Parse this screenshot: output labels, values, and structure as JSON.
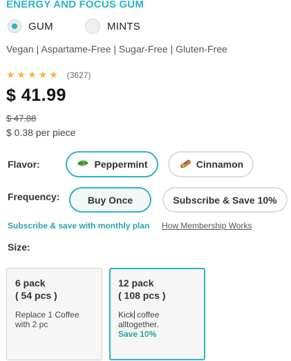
{
  "product": {
    "title": "ENERGY AND FOCUS GUM",
    "type_options": [
      {
        "label": "GUM",
        "selected": true
      },
      {
        "label": "MINTS",
        "selected": false
      }
    ],
    "attributes": "Vegan | Aspartame-Free | Sugar-Free | Gluten-Free",
    "rating": {
      "stars": "★★★★★",
      "value": 5,
      "review_count": "(3627)"
    },
    "price": "$ 41.99",
    "compare_price": "$ 47.88",
    "per_piece": "$ 0.38 per piece"
  },
  "flavor": {
    "label": "Flavor:",
    "options": [
      {
        "label": "Peppermint",
        "icon": "mint-leaf-icon",
        "selected": true
      },
      {
        "label": "Cinnamon",
        "icon": "cinnamon-stick-icon",
        "selected": false
      }
    ]
  },
  "frequency": {
    "label": "Frequency:",
    "options": [
      {
        "label": "Buy Once",
        "selected": true
      },
      {
        "label": "Subscribe & Save 10%",
        "selected": false
      }
    ]
  },
  "subscribe": {
    "text": "Subscribe & save with monthly plan",
    "link": "How Membership Works"
  },
  "size": {
    "label": "Size:",
    "options": [
      {
        "title": "6 pack",
        "count": "( 54 pcs )",
        "desc": "Replace 1 Coffee with 2 pc",
        "selected": false
      },
      {
        "title": "12 pack",
        "count": "( 108 pcs )",
        "desc_before_caret": "Kick",
        "desc_after_caret": " coffee alltogether.",
        "save": "Save 10%",
        "selected": true
      }
    ]
  },
  "colors": {
    "accent": "#2bb3c5",
    "link_teal": "#2aa3a6",
    "star": "#f2b53a"
  }
}
